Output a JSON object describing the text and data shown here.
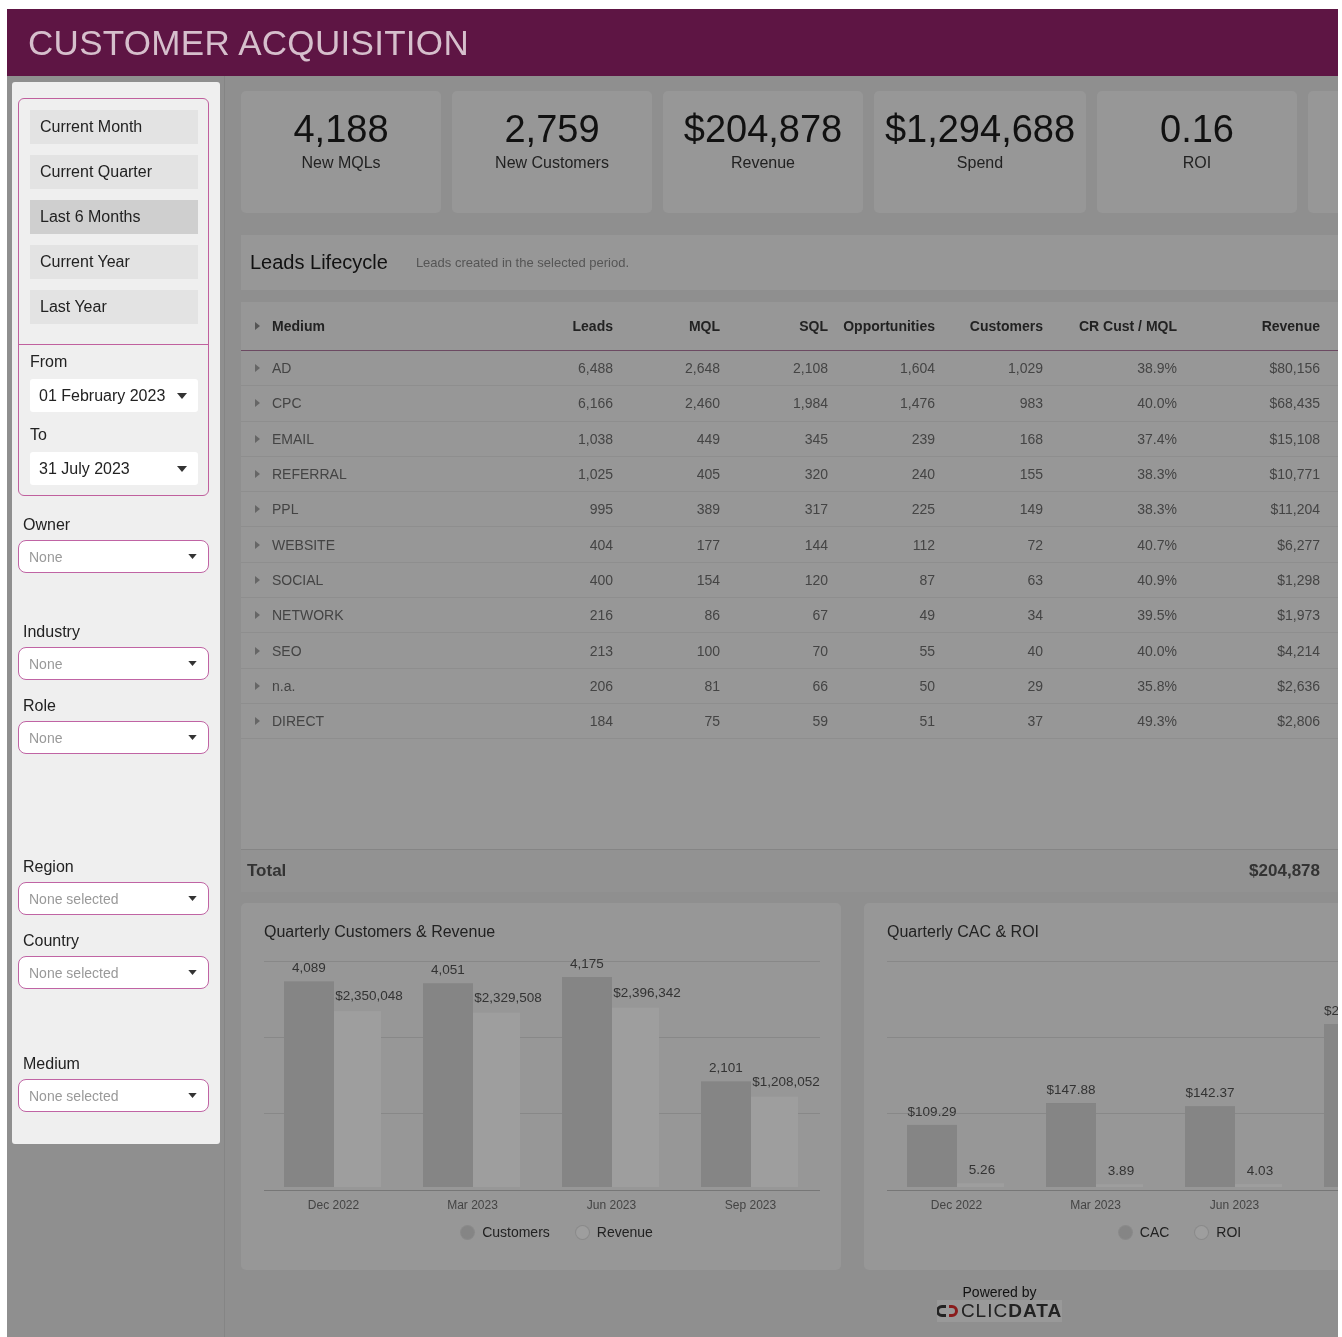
{
  "header": {
    "title": "CUSTOMER ACQUISITION"
  },
  "sidebar": {
    "periods": [
      {
        "label": "Current Month",
        "selected": false
      },
      {
        "label": "Current Quarter",
        "selected": false
      },
      {
        "label": "Last 6 Months",
        "selected": true
      },
      {
        "label": "Current Year",
        "selected": false
      },
      {
        "label": "Last Year",
        "selected": false
      }
    ],
    "from": {
      "label": "From",
      "value": "01 February 2023"
    },
    "to": {
      "label": "To",
      "value": "31 July 2023"
    },
    "filters": [
      {
        "label": "Owner",
        "placeholder": "None"
      },
      {
        "label": "Industry",
        "placeholder": "None"
      },
      {
        "label": "Role",
        "placeholder": "None"
      },
      {
        "label": "Region",
        "placeholder": "None selected"
      },
      {
        "label": "Country",
        "placeholder": "None selected"
      },
      {
        "label": "Medium",
        "placeholder": "None selected"
      }
    ]
  },
  "kpis": [
    {
      "value": "4,188",
      "label": "New MQLs"
    },
    {
      "value": "2,759",
      "label": "New Customers"
    },
    {
      "value": "$204,878",
      "label": "Revenue"
    },
    {
      "value": "$1,294,688",
      "label": "Spend"
    },
    {
      "value": "0.16",
      "label": "ROI"
    }
  ],
  "leads_lifecycle": {
    "title": "Leads Lifecycle",
    "subtitle": "Leads created in the selected period.",
    "columns": [
      "Medium",
      "Leads",
      "MQL",
      "SQL",
      "Opportunities",
      "Customers",
      "CR Cust / MQL",
      "Revenue"
    ],
    "rows": [
      {
        "expanded": false,
        "cells": [
          "AD",
          "6,488",
          "2,648",
          "2,108",
          "1,604",
          "1,029",
          "38.9%",
          "$80,156"
        ]
      },
      {
        "expanded": false,
        "cells": [
          "CPC",
          "6,166",
          "2,460",
          "1,984",
          "1,476",
          "983",
          "40.0%",
          "$68,435"
        ]
      },
      {
        "expanded": false,
        "cells": [
          "EMAIL",
          "1,038",
          "449",
          "345",
          "239",
          "168",
          "37.4%",
          "$15,108"
        ]
      },
      {
        "expanded": false,
        "cells": [
          "REFERRAL",
          "1,025",
          "405",
          "320",
          "240",
          "155",
          "38.3%",
          "$10,771"
        ]
      },
      {
        "expanded": false,
        "cells": [
          "PPL",
          "995",
          "389",
          "317",
          "225",
          "149",
          "38.3%",
          "$11,204"
        ]
      },
      {
        "expanded": false,
        "cells": [
          "WEBSITE",
          "404",
          "177",
          "144",
          "112",
          "72",
          "40.7%",
          "$6,277"
        ]
      },
      {
        "expanded": false,
        "cells": [
          "SOCIAL",
          "400",
          "154",
          "120",
          "87",
          "63",
          "40.9%",
          "$1,298"
        ]
      },
      {
        "expanded": false,
        "cells": [
          "NETWORK",
          "216",
          "86",
          "67",
          "49",
          "34",
          "39.5%",
          "$1,973"
        ]
      },
      {
        "expanded": false,
        "cells": [
          "SEO",
          "213",
          "100",
          "70",
          "55",
          "40",
          "40.0%",
          "$4,214"
        ]
      },
      {
        "expanded": false,
        "cells": [
          "n.a.",
          "206",
          "81",
          "66",
          "50",
          "29",
          "35.8%",
          "$2,636"
        ]
      },
      {
        "expanded": false,
        "cells": [
          "DIRECT",
          "184",
          "75",
          "59",
          "51",
          "37",
          "49.3%",
          "$2,806"
        ]
      }
    ],
    "total": {
      "label": "Total",
      "value": "$204,878"
    }
  },
  "charts": [
    {
      "title": "Quarterly Customers & Revenue",
      "layers": [
        {
          "chart_data": {
            "type": "bar",
            "categories": [
              "Dec 2022",
              "Mar 2023",
              "Jun 2023",
              "Sep 2023"
            ],
            "data_labels": true,
            "series": [
              {
                "name": "Customers",
                "color": "#858585",
                "values": [
                  4089,
                  4051,
                  4175,
                  2101
                ],
                "value_labels": [
                  "4,089",
                  "4,051",
                  "4,175",
                  "2,101"
                ]
              }
            ]
          }
        },
        {
          "chart_data": {
            "type": "bar",
            "data_labels": true,
            "series": [
              {
                "name": "Revenue",
                "color": "#9e9e9e",
                "values": [
                  2350048,
                  2329508,
                  2396342,
                  1208052
                ],
                "value_labels": [
                  "$2,350,048",
                  "$2,329,508",
                  "$2,396,342",
                  "$1,208,052"
                ]
              }
            ]
          }
        }
      ]
    },
    {
      "title": "Quarterly CAC & ROI",
      "layers": [
        {
          "chart_data": {
            "type": "bar",
            "categories": [
              "Dec 2022",
              "Mar 2023",
              "Jun 2023"
            ],
            "data_labels": true,
            "series": [
              {
                "name": "CAC",
                "color": "#858585",
                "values": [
                  109.29,
                  147.88,
                  142.37
                ],
                "value_labels": [
                  "$109.29",
                  "$147.88",
                  "$142.37"
                ]
              }
            ],
            "annotations": [
              {
                "text": "$2"
              }
            ]
          }
        },
        {
          "chart_data": {
            "type": "bar",
            "data_labels": true,
            "series": [
              {
                "name": "ROI",
                "color": "#9e9e9e",
                "values": [
                  5.26,
                  3.89,
                  4.03
                ],
                "value_labels": [
                  "5.26",
                  "3.89",
                  "4.03"
                ]
              }
            ]
          }
        }
      ]
    }
  ],
  "footer": {
    "caption": "Powered by",
    "logo": "CLIC**DATA**"
  }
}
